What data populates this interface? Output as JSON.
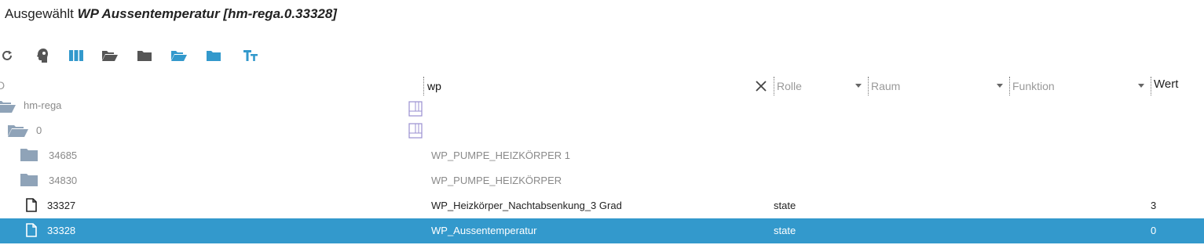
{
  "header": {
    "prefix": "Ausgewählt",
    "object_name": "WP Aussentemperatur [hm-rega.0.33328]"
  },
  "toolbar": {
    "buttons": [
      {
        "name": "refresh-icon",
        "color": "#555555"
      },
      {
        "name": "expert-mode-icon",
        "color": "#555555"
      },
      {
        "name": "columns-icon",
        "color": "#3399cc"
      },
      {
        "name": "folder-open-icon",
        "color": "#555555"
      },
      {
        "name": "folder-closed-icon",
        "color": "#555555"
      },
      {
        "name": "folder-open-icon",
        "color": "#3399cc"
      },
      {
        "name": "folder-closed-icon",
        "color": "#3399cc"
      },
      {
        "name": "text-size-icon",
        "color": "#3399cc"
      }
    ]
  },
  "filters": {
    "id_fragment": "D",
    "name_value": "wp",
    "rolle_placeholder": "Rolle",
    "raum_placeholder": "Raum",
    "funktion_placeholder": "Funktion",
    "wert_header": "Wert"
  },
  "tree": [
    {
      "id": "hm-rega",
      "name": "",
      "role": "",
      "value": "",
      "type": "folder-open",
      "muted": true
    },
    {
      "id": "0",
      "name": "",
      "role": "",
      "value": "",
      "type": "folder-open",
      "muted": true
    },
    {
      "id": "34685",
      "name": "WP_PUMPE_HEIZKÖRPER 1",
      "role": "",
      "value": "",
      "type": "folder",
      "muted": true
    },
    {
      "id": "34830",
      "name": "WP_PUMPE_HEIZKÖRPER",
      "role": "",
      "value": "",
      "type": "folder",
      "muted": true
    },
    {
      "id": "33327",
      "name": "WP_Heizkörper_Nachtabsenkung_3 Grad",
      "role": "state",
      "value": "3",
      "type": "file",
      "muted": false
    },
    {
      "id": "33328",
      "name": "WP_Aussentemperatur",
      "role": "state",
      "value": "0",
      "type": "file",
      "muted": false,
      "selected": true
    }
  ],
  "colors": {
    "accent": "#3399cc",
    "folder": "#8fa3b8",
    "muted_text": "#8a8a8a"
  }
}
